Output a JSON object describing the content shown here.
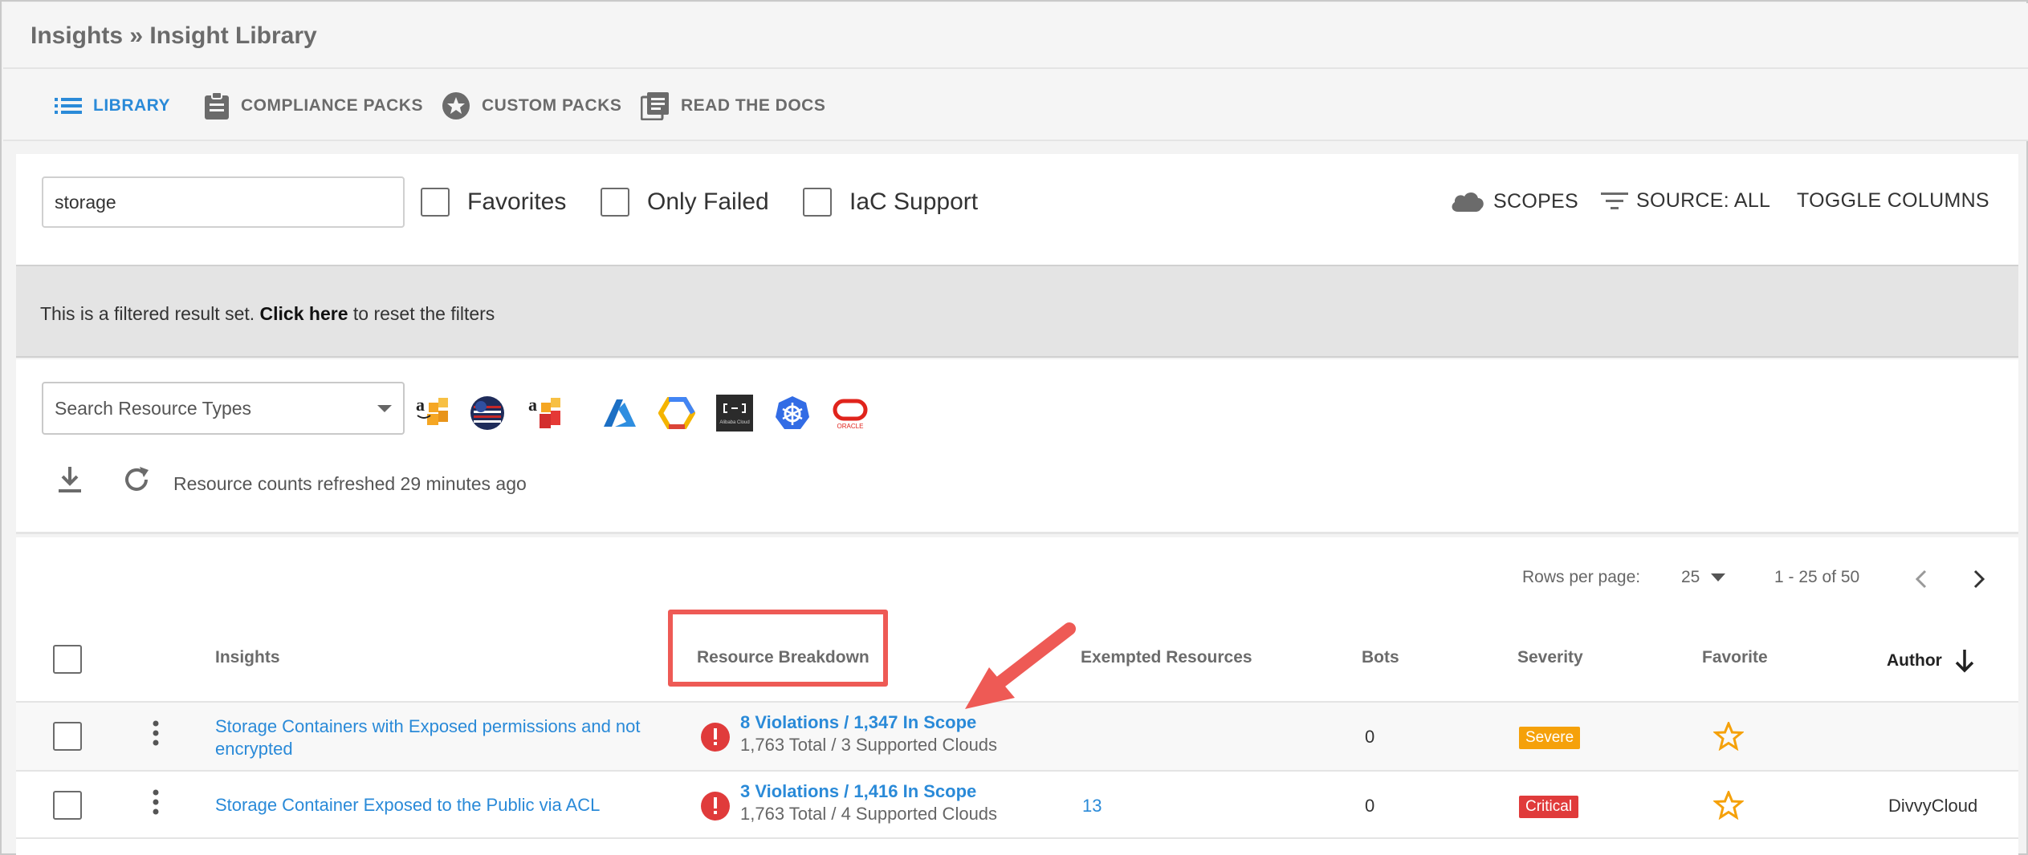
{
  "breadcrumb": "Insights » Insight Library",
  "tabs": [
    {
      "label": "LIBRARY",
      "icon": "list-icon",
      "active": true
    },
    {
      "label": "COMPLIANCE PACKS",
      "icon": "clipboard-icon",
      "active": false
    },
    {
      "label": "CUSTOM PACKS",
      "icon": "star-badge-icon",
      "active": false
    },
    {
      "label": "READ THE DOCS",
      "icon": "docs-icon",
      "active": false
    }
  ],
  "filters": {
    "search_value": "storage",
    "favorites_label": "Favorites",
    "only_failed_label": "Only Failed",
    "iac_label": "IaC Support",
    "scopes_label": "SCOPES",
    "source_label": "SOURCE: ALL",
    "toggle_columns_label": "TOGGLE COLUMNS"
  },
  "banner": {
    "prefix": "This is a filtered result set. ",
    "link": "Click here",
    "suffix": " to reset the filters"
  },
  "resources": {
    "select_placeholder": "Search Resource Types",
    "clouds": [
      "aws-icon",
      "aws-gov-icon",
      "aws-china-icon",
      "azure-icon",
      "gcp-icon",
      "alibaba-cloud-icon",
      "kubernetes-icon",
      "oracle-icon"
    ],
    "alibaba_label": "Alibaba Cloud",
    "oracle_label": "ORACLE",
    "refresh_text": "Resource counts refreshed 29 minutes ago"
  },
  "pagination": {
    "rows_label": "Rows per page:",
    "rows_value": "25",
    "range": "1 - 25 of 50"
  },
  "columns": {
    "insights": "Insights",
    "resource_breakdown": "Resource Breakdown",
    "exempted": "Exempted Resources",
    "bots": "Bots",
    "severity": "Severity",
    "favorite": "Favorite",
    "author": "Author"
  },
  "rows": [
    {
      "insight_line1": "Storage Containers with Exposed permissions and not",
      "insight_line2": "encrypted",
      "violations": "8 Violations / 1,347 In Scope",
      "totals": "1,763 Total / 3 Supported Clouds",
      "exempted": "",
      "bots": "0",
      "severity": "Severe",
      "author": ""
    },
    {
      "insight_line1": "Storage Container Exposed to the Public via ACL",
      "insight_line2": "",
      "violations": "3 Violations / 1,416 In Scope",
      "totals": "1,763 Total / 4 Supported Clouds",
      "exempted": "13",
      "bots": "0",
      "severity": "Critical",
      "author": "DivvyCloud"
    }
  ],
  "colors": {
    "accent": "#2a8ad8",
    "annotation": "#ee5a55",
    "severe": "#f5a10a",
    "critical": "#e03b3b"
  }
}
